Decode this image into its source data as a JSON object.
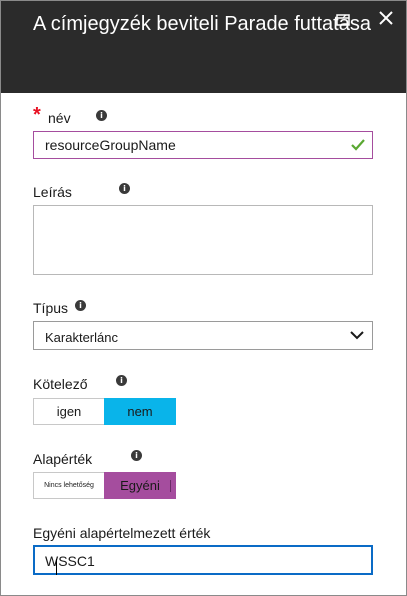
{
  "header": {
    "title": "A címjegyzék beviteli Parade futtatása"
  },
  "icons": {
    "maximize": "maximize-icon",
    "close": "close-icon",
    "info": "info-icon",
    "check": "checkmark-icon",
    "chevron": "chevron-down-icon"
  },
  "colors": {
    "header_bg": "#2b2b2b",
    "required": "#e81123",
    "accent_purple": "#a54d9e",
    "accent_blue": "#09b4ea",
    "focus_blue": "#0a6bc6",
    "check_green": "#5aa832"
  },
  "fields": {
    "name": {
      "label": "név",
      "value": "resourceGroupName",
      "required_mark": "*"
    },
    "description": {
      "label": "Leírás",
      "value": ""
    },
    "type": {
      "label": "Típus",
      "selected": "Karakterlánc"
    },
    "required": {
      "label": "Kötelező",
      "options": [
        "igen",
        "nem"
      ],
      "selected": "nem"
    },
    "default": {
      "label": "Alapérték",
      "options": [
        "Nincs lehetőség",
        "Egyéni"
      ],
      "selected": "Egyéni"
    },
    "custom_default": {
      "label": "Egyéni alapértelmezett érték",
      "value": "WSSC1"
    }
  }
}
